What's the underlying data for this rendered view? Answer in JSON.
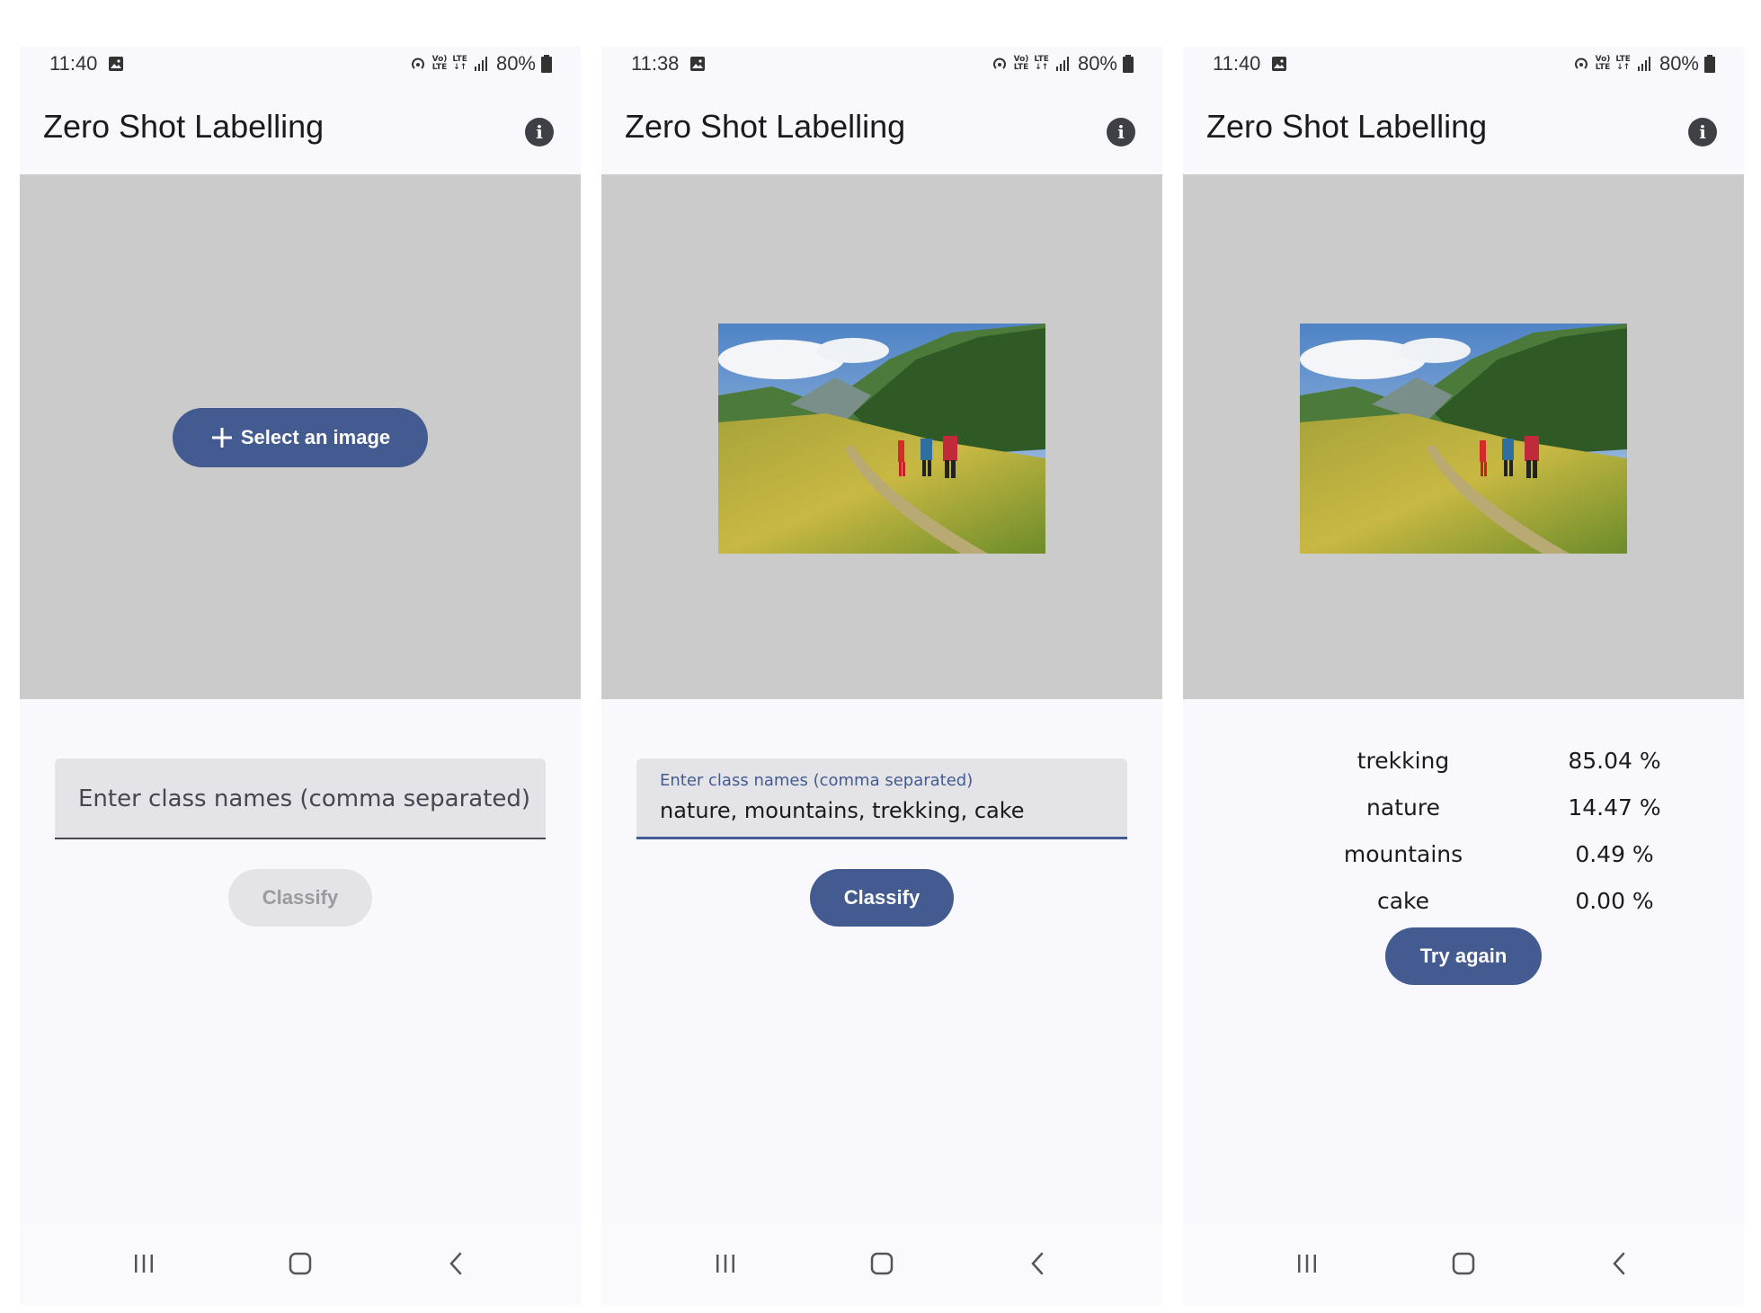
{
  "app": {
    "title": "Zero Shot Labelling",
    "accent_color": "#435b90",
    "info_glyph": "i"
  },
  "screens": [
    {
      "status": {
        "time": "11:40",
        "battery": "80%",
        "lte1": "Vo)\nLTE",
        "lte2": "LTE\n↓↑"
      },
      "select_button_label": "Select an image",
      "field_placeholder": "Enter class names (comma separated)",
      "classify_label": "Classify"
    },
    {
      "status": {
        "time": "11:38",
        "battery": "80%",
        "lte1": "Vo)\nLTE",
        "lte2": "LTE\n↓↑"
      },
      "field_label": "Enter class names (comma separated)",
      "field_value": "nature, mountains, trekking, cake",
      "classify_label": "Classify"
    },
    {
      "status": {
        "time": "11:40",
        "battery": "80%",
        "lte1": "Vo)\nLTE",
        "lte2": "LTE\n↓↑"
      },
      "results": [
        {
          "label": "trekking",
          "value": "85.04 %"
        },
        {
          "label": "nature",
          "value": "14.47 %"
        },
        {
          "label": "mountains",
          "value": "0.49 %"
        },
        {
          "label": "cake",
          "value": "0.00 %"
        }
      ],
      "try_again_label": "Try again"
    }
  ],
  "icons": {
    "gallery": "image-icon",
    "hotspot": "hotspot-icon",
    "signal": "signal-icon",
    "battery": "battery-icon",
    "info": "info-icon",
    "plus": "plus-icon",
    "recents": "recents-icon",
    "home": "home-icon",
    "back": "back-icon"
  }
}
